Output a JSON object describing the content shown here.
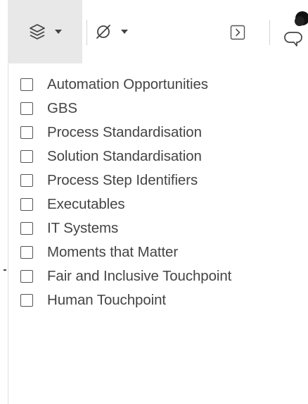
{
  "toolbar": {
    "layers_icon": "layers-icon",
    "filter_icon": "filter-off-icon",
    "expand_icon": "panel-expand-icon",
    "comment_icon": "comment-icon"
  },
  "dropdown": {
    "items": [
      {
        "label": "Automation Opportunities",
        "checked": false
      },
      {
        "label": "GBS",
        "checked": false
      },
      {
        "label": "Process Standardisation",
        "checked": false
      },
      {
        "label": "Solution Standardisation",
        "checked": false
      },
      {
        "label": "Process Step Identifiers",
        "checked": false
      },
      {
        "label": "Executables",
        "checked": false
      },
      {
        "label": "IT Systems",
        "checked": false
      },
      {
        "label": "Moments that Matter",
        "checked": false
      },
      {
        "label": "Fair and Inclusive Touchpoint",
        "checked": false
      },
      {
        "label": "Human Touchpoint",
        "checked": false
      }
    ]
  }
}
